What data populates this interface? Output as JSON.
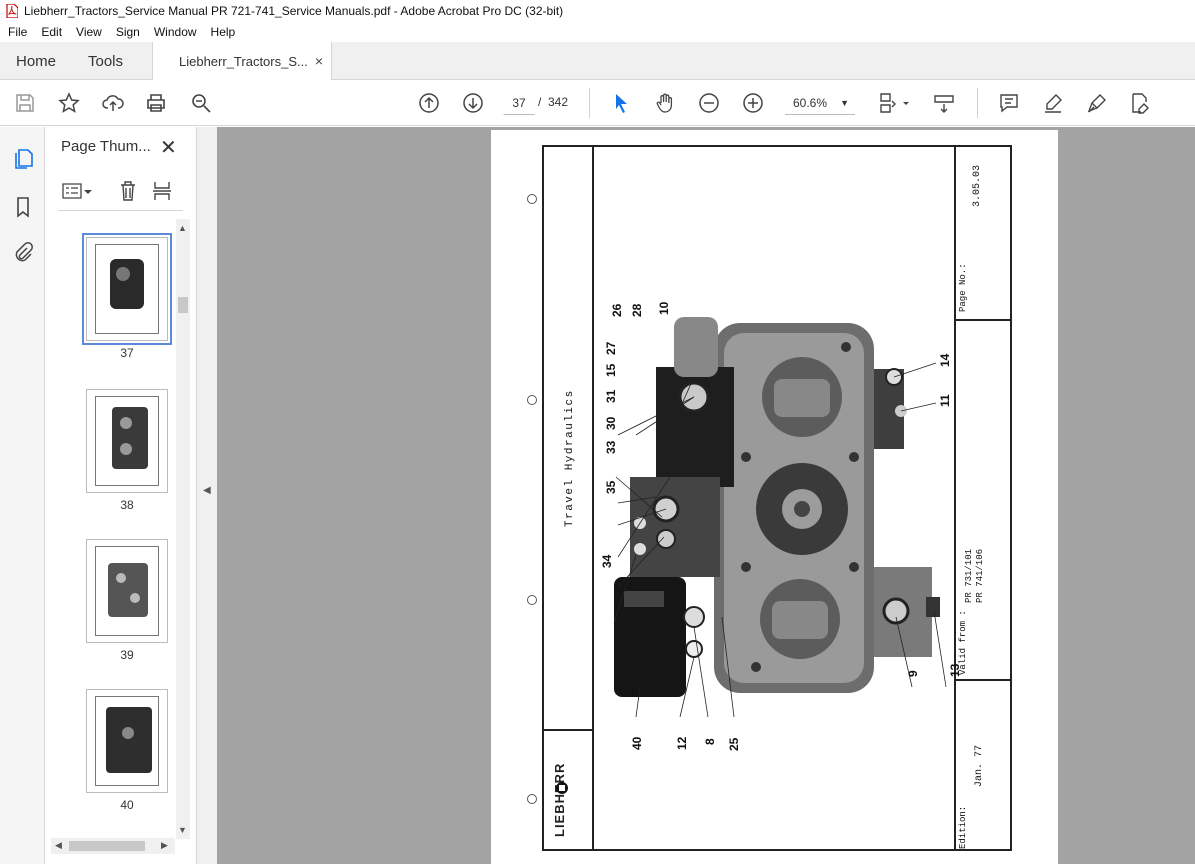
{
  "window": {
    "title": "Liebherr_Tractors_Service Manual PR 721-741_Service Manuals.pdf - Adobe Acrobat Pro DC (32-bit)"
  },
  "menu": [
    "File",
    "Edit",
    "View",
    "Sign",
    "Window",
    "Help"
  ],
  "tabs": {
    "home": "Home",
    "tools": "Tools",
    "document": "Liebherr_Tractors_S...",
    "close_symbol": "×"
  },
  "toolbar": {
    "current_page": "37",
    "separator": "/",
    "total_pages": "342",
    "zoom": "60.6%",
    "icons": [
      "save-icon",
      "star-icon",
      "upload-icon",
      "print-icon",
      "search-zoom-icon",
      "page-up-icon",
      "page-down-icon",
      "select-cursor-icon",
      "hand-icon",
      "zoom-out-icon",
      "zoom-in-icon",
      "fit-page-icon",
      "scroll-mode-icon",
      "comment-icon",
      "highlight-icon",
      "sign-icon",
      "edit-pdf-icon"
    ]
  },
  "sidebar": {
    "title": "Page Thum...",
    "close_symbol": "✕",
    "thumbnails": [
      {
        "label": "37",
        "selected": true
      },
      {
        "label": "38",
        "selected": false
      },
      {
        "label": "39",
        "selected": false
      },
      {
        "label": "40",
        "selected": false
      }
    ]
  },
  "document_page": {
    "section_title": "Travel Hydraulics",
    "page_no_label": "Page No.:",
    "page_no_value": "3.05.03",
    "valid_from_label": "Valid from :",
    "valid_from_line1": "PR 731/101",
    "valid_from_line2": "PR 741/106",
    "edition_label": "Edition:",
    "edition_value": "Jan. 77",
    "brand": "LIEBHERR",
    "callouts": [
      "26",
      "28",
      "10",
      "27",
      "15",
      "31",
      "30",
      "33",
      "35",
      "34",
      "40",
      "12",
      "8",
      "25",
      "14",
      "11",
      "9",
      "13"
    ]
  }
}
